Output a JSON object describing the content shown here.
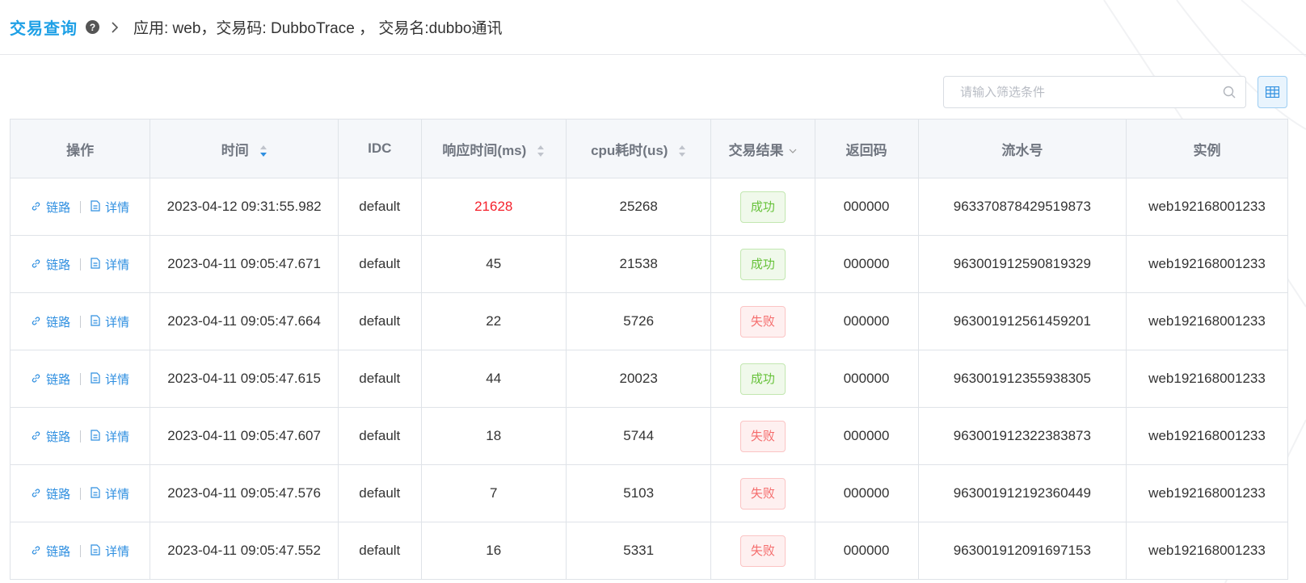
{
  "header": {
    "title": "交易查询",
    "breadcrumb": "应用: web，交易码: DubboTrace ， 交易名:dubbo通讯"
  },
  "search": {
    "placeholder": "请输入筛选条件"
  },
  "table": {
    "columns": [
      "操作",
      "时间",
      "IDC",
      "响应时间(ms)",
      "cpu耗时(us)",
      "交易结果",
      "返回码",
      "流水号",
      "实例"
    ],
    "action_labels": {
      "trace": "链路",
      "detail": "详情"
    },
    "rows": [
      {
        "time": "2023-04-12 09:31:55.982",
        "idc": "default",
        "resp": "21628",
        "cpu": "25268",
        "result": "成功",
        "code": "000000",
        "serial": "963370878429519873",
        "instance": "web192168001233"
      },
      {
        "time": "2023-04-11 09:05:47.671",
        "idc": "default",
        "resp": "45",
        "cpu": "21538",
        "result": "成功",
        "code": "000000",
        "serial": "963001912590819329",
        "instance": "web192168001233"
      },
      {
        "time": "2023-04-11 09:05:47.664",
        "idc": "default",
        "resp": "22",
        "cpu": "5726",
        "result": "失败",
        "code": "000000",
        "serial": "963001912561459201",
        "instance": "web192168001233"
      },
      {
        "time": "2023-04-11 09:05:47.615",
        "idc": "default",
        "resp": "44",
        "cpu": "20023",
        "result": "成功",
        "code": "000000",
        "serial": "963001912355938305",
        "instance": "web192168001233"
      },
      {
        "time": "2023-04-11 09:05:47.607",
        "idc": "default",
        "resp": "18",
        "cpu": "5744",
        "result": "失败",
        "code": "000000",
        "serial": "963001912322383873",
        "instance": "web192168001233"
      },
      {
        "time": "2023-04-11 09:05:47.576",
        "idc": "default",
        "resp": "7",
        "cpu": "5103",
        "result": "失败",
        "code": "000000",
        "serial": "963001912192360449",
        "instance": "web192168001233"
      },
      {
        "time": "2023-04-11 09:05:47.552",
        "idc": "default",
        "resp": "16",
        "cpu": "5331",
        "result": "失败",
        "code": "000000",
        "serial": "963001912091697153",
        "instance": "web192168001233"
      }
    ]
  }
}
